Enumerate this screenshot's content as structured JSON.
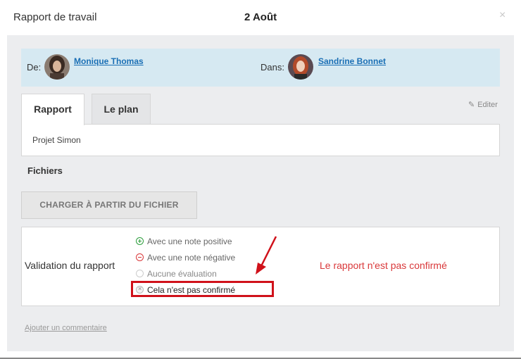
{
  "header": {
    "title": "Rapport de travail",
    "date": "2 Août",
    "close_symbol": "×"
  },
  "people": {
    "from_label": "De:",
    "from_name": "Monique Thomas",
    "to_label": "Dans:",
    "to_name": "Sandrine Bonnet"
  },
  "tabs": [
    {
      "label": "Rapport",
      "active": true
    },
    {
      "label": "Le plan",
      "active": false
    }
  ],
  "edit_label": "Editer",
  "report": {
    "content": "Projet Simon"
  },
  "files": {
    "label": "Fichiers",
    "upload_button": "CHARGER À PARTIR DU FICHIER"
  },
  "validation": {
    "label": "Validation du rapport",
    "options": [
      {
        "label": "Avec une note positive",
        "icon": "plus-circle-icon"
      },
      {
        "label": "Avec une note négative",
        "icon": "minus-circle-icon"
      },
      {
        "label": "Aucune évaluation",
        "icon": "empty-circle-icon"
      },
      {
        "label": "Cela n'est pas confirmé",
        "icon": "x-circle-icon",
        "selected": true
      }
    ],
    "status": "Le rapport n'est pas confirmé"
  },
  "comment_link": "Ajouter un commentaire",
  "colors": {
    "accent_red": "#d0111a",
    "link_blue": "#1a6fb5",
    "people_bg": "#d6e9f2",
    "panel_bg": "#ecedef"
  }
}
